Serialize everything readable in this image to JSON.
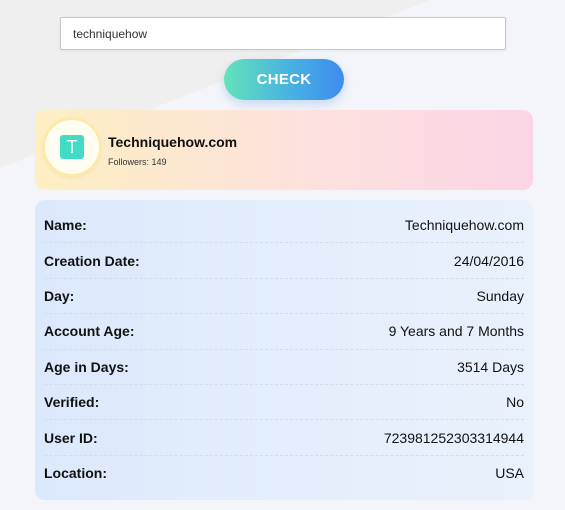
{
  "search": {
    "value": "techniquehow"
  },
  "check_button": {
    "label": "CHECK"
  },
  "profile": {
    "avatar_letter": "T",
    "name": "Techniquehow.com",
    "followers": "Followers: 149"
  },
  "details": {
    "rows": [
      {
        "label": "Name:",
        "value": "Techniquehow.com"
      },
      {
        "label": "Creation Date:",
        "value": "24/04/2016"
      },
      {
        "label": "Day:",
        "value": "Sunday"
      },
      {
        "label": "Account Age:",
        "value": "9 Years and 7 Months"
      },
      {
        "label": "Age in Days:",
        "value": "3514 Days"
      },
      {
        "label": "Verified:",
        "value": "No"
      },
      {
        "label": "User ID:",
        "value": "723981252303314944"
      },
      {
        "label": "Location:",
        "value": "USA"
      }
    ]
  },
  "colors": {
    "button_gradient_start": "#63e3b8",
    "button_gradient_end": "#3f8bf0",
    "avatar": "#41dcc6"
  }
}
